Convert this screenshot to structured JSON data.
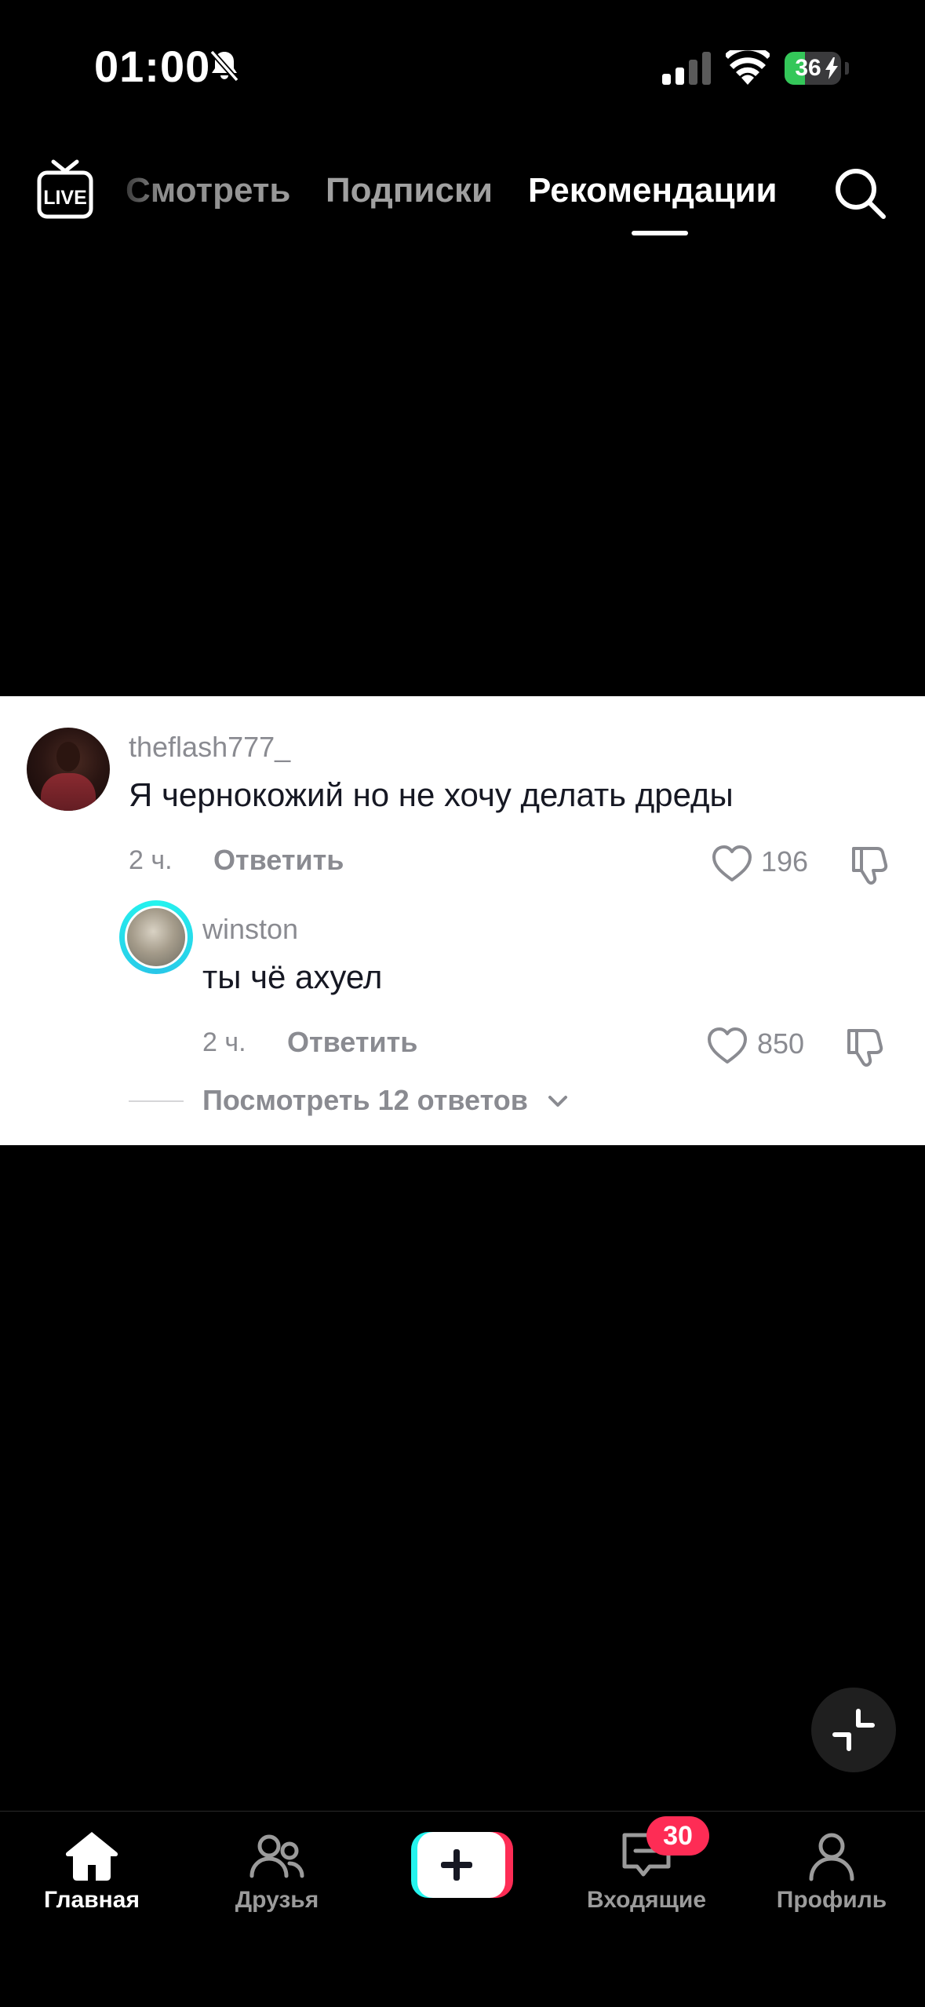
{
  "status_bar": {
    "time": "01:00",
    "battery_level": "36",
    "battery_fraction": 0.36,
    "icons": [
      "bell-slash-icon",
      "signal-icon",
      "wifi-icon",
      "battery-charging-icon"
    ]
  },
  "top_nav": {
    "live_icon": "live-tv-icon",
    "tabs": [
      {
        "label": "Смотреть",
        "active": false
      },
      {
        "label": "Подписки",
        "active": false
      },
      {
        "label": "Рекомендации",
        "active": true
      }
    ],
    "search_icon": "search-icon"
  },
  "comment": {
    "username": "theflash777_",
    "text": "Я чернокожий но не хочу делать дреды",
    "time": "2 ч.",
    "reply_label": "Ответить",
    "likes": "196",
    "reply": {
      "username": "winston",
      "text": "ты чё ахуел",
      "time": "2 ч.",
      "reply_label": "Ответить",
      "likes": "850"
    },
    "view_replies_label": "Посмотреть 12 ответов"
  },
  "colors": {
    "background": "#000000",
    "card": "#ffffff",
    "accent_red": "#fe2c55",
    "accent_cyan": "#25f4ee",
    "muted_text": "#8a8b91"
  },
  "tab_bar": {
    "items": [
      {
        "label": "Главная",
        "icon": "home-icon",
        "active": true
      },
      {
        "label": "Друзья",
        "icon": "friends-icon",
        "active": false
      },
      {
        "label": "",
        "icon": "plus-icon",
        "active": false
      },
      {
        "label": "Входящие",
        "icon": "inbox-icon",
        "active": false,
        "badge": "30"
      },
      {
        "label": "Профиль",
        "icon": "profile-icon",
        "active": false
      }
    ]
  }
}
